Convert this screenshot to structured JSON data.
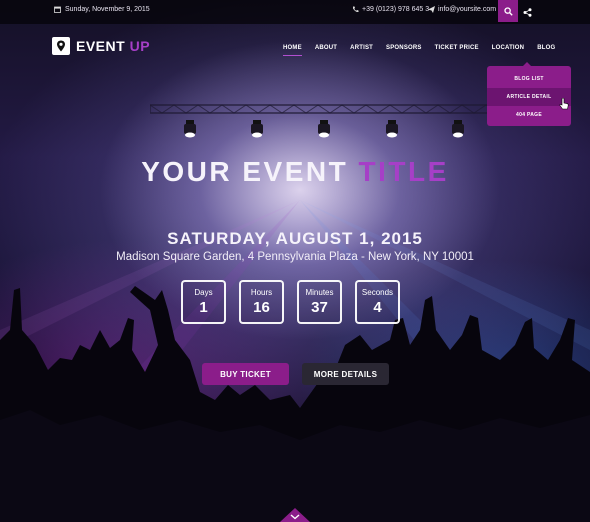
{
  "topbar": {
    "date": "Sunday, November 9, 2015",
    "phone": "+39 (0123) 978 645 3",
    "email": "info@yoursite.com"
  },
  "logo": {
    "text_main": "EVENT",
    "text_accent": "UP"
  },
  "nav": {
    "items": [
      "HOME",
      "ABOUT",
      "ARTIST",
      "SPONSORS",
      "TICKET PRICE",
      "LOCATION",
      "BLOG"
    ],
    "active": "HOME"
  },
  "blog_menu": {
    "items": [
      "BLOG LIST",
      "ARTICLE DETAIL",
      "404 PAGE"
    ],
    "hovered": "ARTICLE DETAIL"
  },
  "hero": {
    "title_main": "YOUR EVENT",
    "title_accent": "TITLE",
    "date": "SATURDAY, AUGUST 1, 2015",
    "venue": "Madison Square Garden, 4 Pennsylvania Plaza - New York, NY 10001"
  },
  "countdown": [
    {
      "label": "Days",
      "value": "1"
    },
    {
      "label": "Hours",
      "value": "16"
    },
    {
      "label": "Minutes",
      "value": "37"
    },
    {
      "label": "Seconds",
      "value": "4"
    }
  ],
  "buttons": {
    "buy": "BUY TICKET",
    "more": "MORE DETAILS"
  },
  "colors": {
    "accent": "#8b1d8a",
    "accent_text": "#a63fc7",
    "dark_button": "#2a2733"
  },
  "icons": [
    "calendar-icon",
    "phone-icon",
    "send-icon",
    "search-icon",
    "share-icon",
    "location-pin-icon",
    "cursor-icon",
    "chevron-down-icon"
  ]
}
